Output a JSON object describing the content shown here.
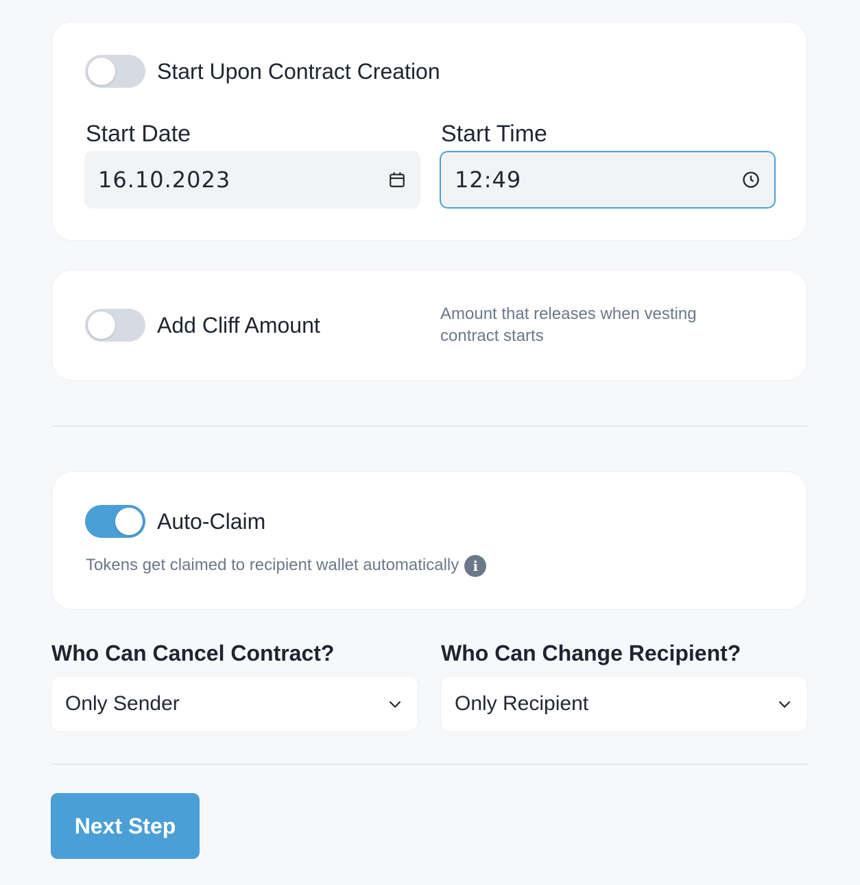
{
  "start_section": {
    "toggle_label": "Start Upon Contract Creation",
    "toggle_on": false,
    "date_label": "Start Date",
    "date_value": "16.10.2023",
    "time_label": "Start Time",
    "time_value": "12:49"
  },
  "cliff_section": {
    "toggle_label": "Add Cliff Amount",
    "toggle_on": false,
    "hint_line1": "Amount that releases when vesting",
    "hint_line2": "contract starts"
  },
  "claim_section": {
    "toggle_label": "Auto-Claim",
    "toggle_on": true,
    "hint": "Tokens get claimed to recipient wallet automatically",
    "info_glyph": "i"
  },
  "permissions": {
    "cancel_label": "Who Can Cancel Contract?",
    "cancel_value": "Only Sender",
    "recipient_label": "Who Can Change Recipient?",
    "recipient_value": "Only Recipient"
  },
  "actions": {
    "next_label": "Next Step"
  },
  "colors": {
    "accent": "#4a9fd6",
    "toggle_off": "#d6dbe3",
    "muted_text": "#6b778a"
  }
}
